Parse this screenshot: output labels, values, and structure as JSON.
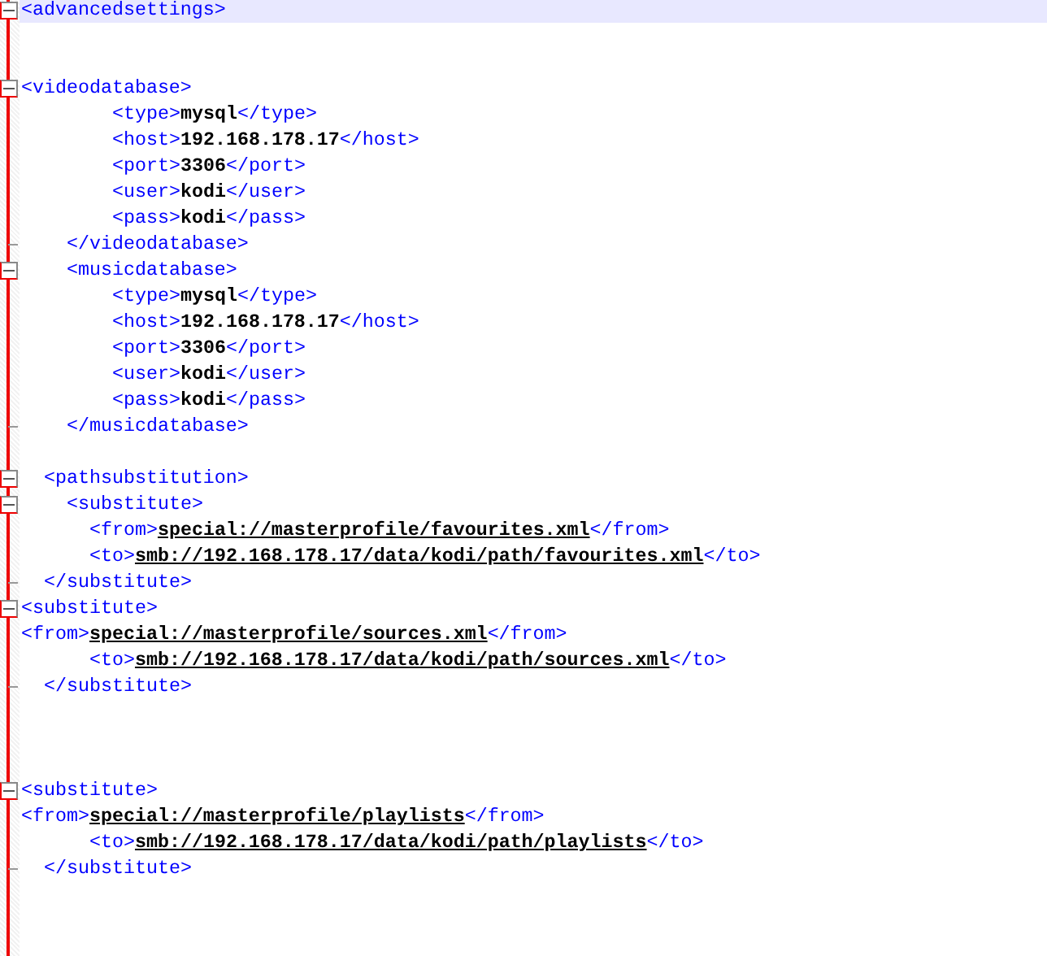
{
  "editor": {
    "lines": [
      {
        "current": true,
        "fold_start": true,
        "fold_end": false,
        "tokens": [
          {
            "kind": "tag",
            "text": "<advancedsettings>"
          }
        ]
      },
      {
        "current": false,
        "fold_start": false,
        "fold_end": false
      },
      {
        "current": false,
        "fold_start": false,
        "fold_end": false
      },
      {
        "current": false,
        "fold_start": true,
        "fold_end": false,
        "tokens": [
          {
            "kind": "tag",
            "text": "<videodatabase>"
          }
        ]
      },
      {
        "current": false,
        "fold_start": false,
        "fold_end": false,
        "tokens": [
          {
            "kind": "tag",
            "text": "        <type>"
          },
          {
            "kind": "value",
            "text": "mysql"
          },
          {
            "kind": "tag",
            "text": "</type>"
          }
        ]
      },
      {
        "current": false,
        "fold_start": false,
        "fold_end": false,
        "tokens": [
          {
            "kind": "tag",
            "text": "        <host>"
          },
          {
            "kind": "value",
            "text": "192.168.178.17"
          },
          {
            "kind": "tag",
            "text": "</host>"
          }
        ]
      },
      {
        "current": false,
        "fold_start": false,
        "fold_end": false,
        "tokens": [
          {
            "kind": "tag",
            "text": "        <port>"
          },
          {
            "kind": "value",
            "text": "3306"
          },
          {
            "kind": "tag",
            "text": "</port>"
          }
        ]
      },
      {
        "current": false,
        "fold_start": false,
        "fold_end": false,
        "tokens": [
          {
            "kind": "tag",
            "text": "        <user>"
          },
          {
            "kind": "value",
            "text": "kodi"
          },
          {
            "kind": "tag",
            "text": "</user>"
          }
        ]
      },
      {
        "current": false,
        "fold_start": false,
        "fold_end": false,
        "tokens": [
          {
            "kind": "tag",
            "text": "        <pass>"
          },
          {
            "kind": "value",
            "text": "kodi"
          },
          {
            "kind": "tag",
            "text": "</pass>"
          }
        ]
      },
      {
        "current": false,
        "fold_start": false,
        "fold_end": true,
        "tokens": [
          {
            "kind": "tag",
            "text": "    </videodatabase>"
          }
        ]
      },
      {
        "current": false,
        "fold_start": true,
        "fold_end": false,
        "tokens": [
          {
            "kind": "tag",
            "text": "    <musicdatabase>"
          }
        ]
      },
      {
        "current": false,
        "fold_start": false,
        "fold_end": false,
        "tokens": [
          {
            "kind": "tag",
            "text": "        <type>"
          },
          {
            "kind": "value",
            "text": "mysql"
          },
          {
            "kind": "tag",
            "text": "</type>"
          }
        ]
      },
      {
        "current": false,
        "fold_start": false,
        "fold_end": false,
        "tokens": [
          {
            "kind": "tag",
            "text": "        <host>"
          },
          {
            "kind": "value",
            "text": "192.168.178.17"
          },
          {
            "kind": "tag",
            "text": "</host>"
          }
        ]
      },
      {
        "current": false,
        "fold_start": false,
        "fold_end": false,
        "tokens": [
          {
            "kind": "tag",
            "text": "        <port>"
          },
          {
            "kind": "value",
            "text": "3306"
          },
          {
            "kind": "tag",
            "text": "</port>"
          }
        ]
      },
      {
        "current": false,
        "fold_start": false,
        "fold_end": false,
        "tokens": [
          {
            "kind": "tag",
            "text": "        <user>"
          },
          {
            "kind": "value",
            "text": "kodi"
          },
          {
            "kind": "tag",
            "text": "</user>"
          }
        ]
      },
      {
        "current": false,
        "fold_start": false,
        "fold_end": false,
        "tokens": [
          {
            "kind": "tag",
            "text": "        <pass>"
          },
          {
            "kind": "value",
            "text": "kodi"
          },
          {
            "kind": "tag",
            "text": "</pass>"
          }
        ]
      },
      {
        "current": false,
        "fold_start": false,
        "fold_end": true,
        "tokens": [
          {
            "kind": "tag",
            "text": "    </musicdatabase>"
          }
        ]
      },
      {
        "current": false,
        "fold_start": false,
        "fold_end": false
      },
      {
        "current": false,
        "fold_start": true,
        "fold_end": false,
        "tokens": [
          {
            "kind": "tag",
            "text": "  <pathsubstitution>"
          }
        ]
      },
      {
        "current": false,
        "fold_start": true,
        "fold_end": false,
        "tokens": [
          {
            "kind": "tag",
            "text": "    <substitute>"
          }
        ]
      },
      {
        "current": false,
        "fold_start": false,
        "fold_end": false,
        "tokens": [
          {
            "kind": "tag",
            "text": "      <from>"
          },
          {
            "kind": "link",
            "text": "special://masterprofile/favourites.xml"
          },
          {
            "kind": "tag",
            "text": "</from>"
          }
        ]
      },
      {
        "current": false,
        "fold_start": false,
        "fold_end": false,
        "tokens": [
          {
            "kind": "tag",
            "text": "      <to>"
          },
          {
            "kind": "link",
            "text": "smb://192.168.178.17/data/kodi/path/favourites.xml"
          },
          {
            "kind": "tag",
            "text": "</to>"
          }
        ]
      },
      {
        "current": false,
        "fold_start": false,
        "fold_end": true,
        "tokens": [
          {
            "kind": "tag",
            "text": "  </substitute>"
          }
        ]
      },
      {
        "current": false,
        "fold_start": true,
        "fold_end": false,
        "tokens": [
          {
            "kind": "tag",
            "text": "<substitute>"
          }
        ]
      },
      {
        "current": false,
        "fold_start": false,
        "fold_end": false,
        "tokens": [
          {
            "kind": "tag",
            "text": "<from>"
          },
          {
            "kind": "link",
            "text": "special://masterprofile/sources.xml"
          },
          {
            "kind": "tag",
            "text": "</from>"
          }
        ]
      },
      {
        "current": false,
        "fold_start": false,
        "fold_end": false,
        "tokens": [
          {
            "kind": "tag",
            "text": "      <to>"
          },
          {
            "kind": "link",
            "text": "smb://192.168.178.17/data/kodi/path/sources.xml"
          },
          {
            "kind": "tag",
            "text": "</to>"
          }
        ]
      },
      {
        "current": false,
        "fold_start": false,
        "fold_end": true,
        "tokens": [
          {
            "kind": "tag",
            "text": "  </substitute>"
          }
        ]
      },
      {
        "current": false,
        "fold_start": false,
        "fold_end": false
      },
      {
        "current": false,
        "fold_start": false,
        "fold_end": false
      },
      {
        "current": false,
        "fold_start": false,
        "fold_end": false
      },
      {
        "current": false,
        "fold_start": true,
        "fold_end": false,
        "tokens": [
          {
            "kind": "tag",
            "text": "<substitute>"
          }
        ]
      },
      {
        "current": false,
        "fold_start": false,
        "fold_end": false,
        "tokens": [
          {
            "kind": "tag",
            "text": "<from>"
          },
          {
            "kind": "link",
            "text": "special://masterprofile/playlists"
          },
          {
            "kind": "tag",
            "text": "</from>"
          }
        ]
      },
      {
        "current": false,
        "fold_start": false,
        "fold_end": false,
        "tokens": [
          {
            "kind": "tag",
            "text": "      <to>"
          },
          {
            "kind": "link",
            "text": "smb://192.168.178.17/data/kodi/path/playlists"
          },
          {
            "kind": "tag",
            "text": "</to>"
          }
        ]
      },
      {
        "current": false,
        "fold_start": false,
        "fold_end": true,
        "tokens": [
          {
            "kind": "tag",
            "text": "  </substitute>"
          }
        ]
      }
    ]
  }
}
